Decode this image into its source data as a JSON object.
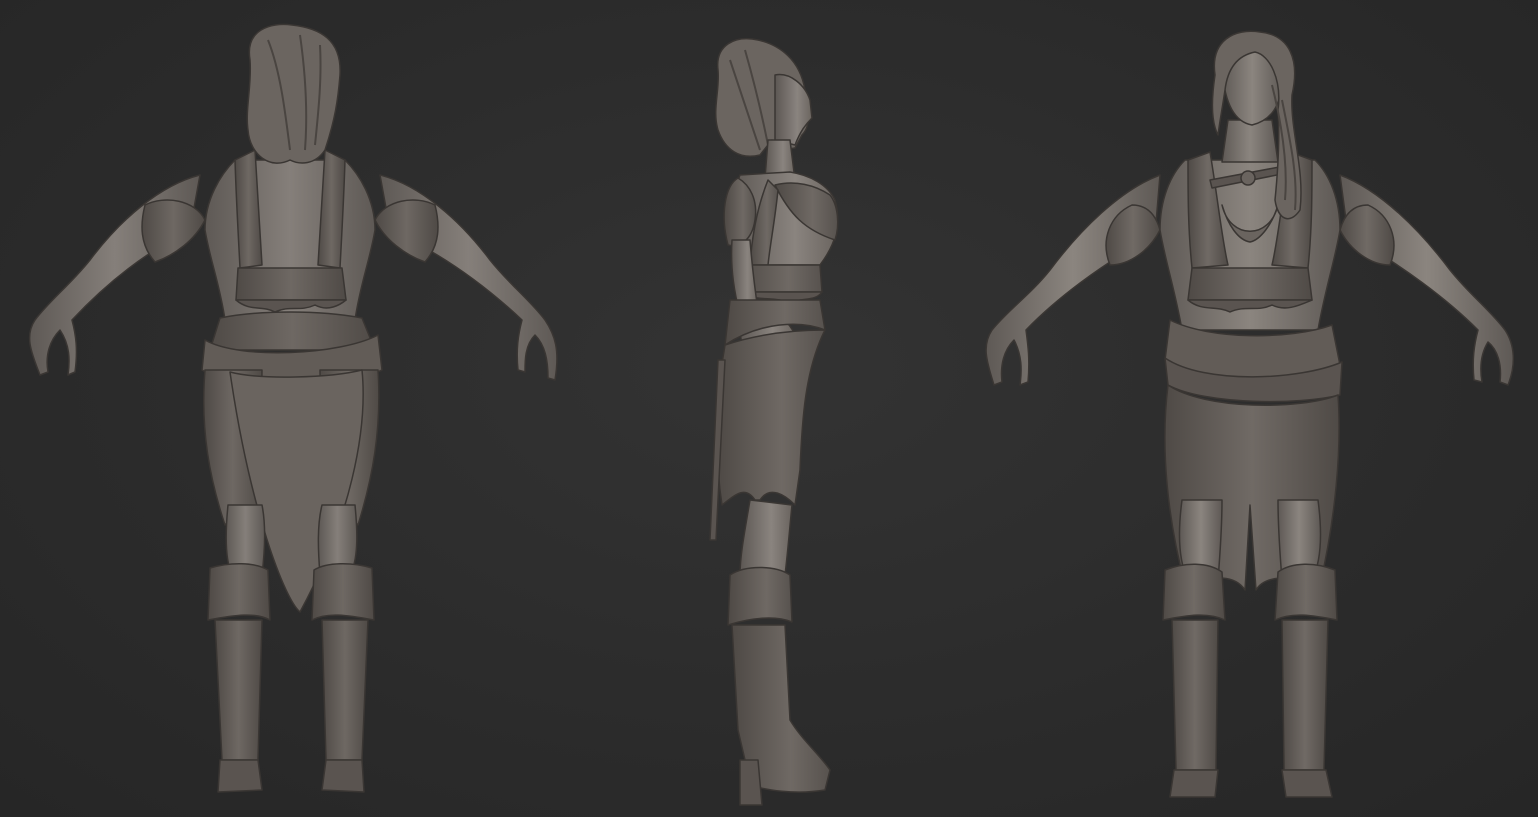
{
  "scene": {
    "background": "#2c2c2c",
    "material_base": "#6f6964",
    "material_light": "#8d8782",
    "material_dark": "#4c4743",
    "outline": "#3a3633"
  },
  "views": [
    {
      "id": "back",
      "icon": "figure-back-view-icon"
    },
    {
      "id": "side",
      "icon": "figure-side-view-icon"
    },
    {
      "id": "front",
      "icon": "figure-front-view-icon"
    }
  ]
}
